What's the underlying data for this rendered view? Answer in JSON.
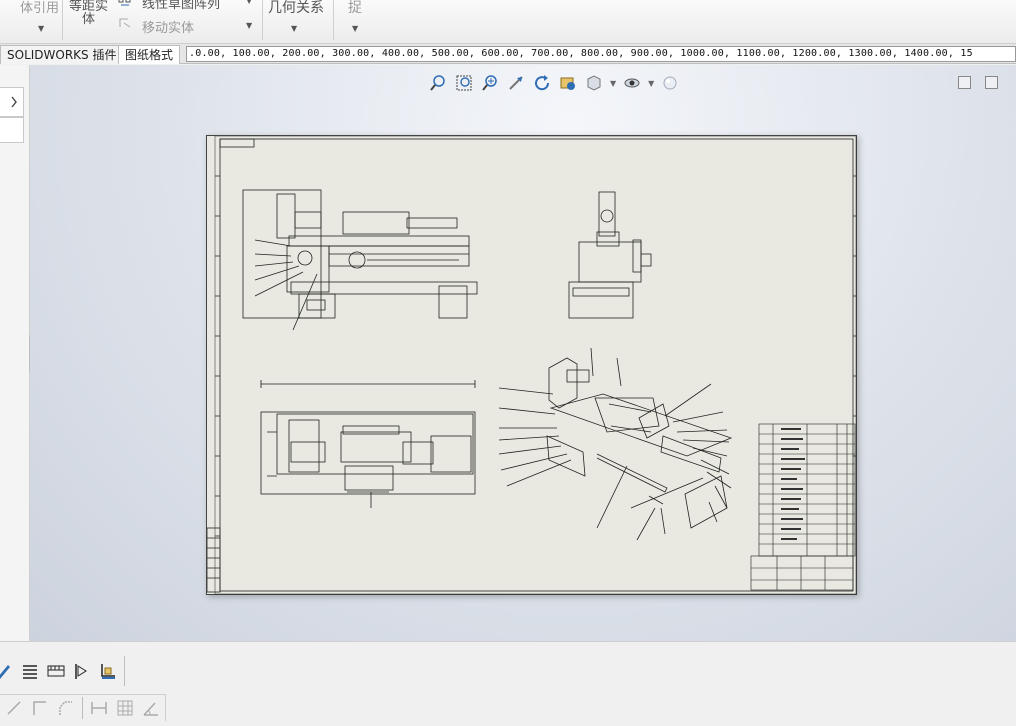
{
  "ribbon": {
    "body_ref": "体引用",
    "equal_body_1": "等距实",
    "equal_body_2": "体",
    "linear_pattern": "线性草图阵列",
    "move_entity": "移动实体",
    "relations": "几何关系",
    "capture": "捉"
  },
  "tabs": {
    "solidworks_addins": "SOLIDWORKS 插件",
    "sheet_format": "图纸格式"
  },
  "ruler": {
    "marks": ".0.00, 100.00, 200.00, 300.00, 400.00, 500.00, 600.00, 700.00, 800.00, 900.00, 1000.00, 1100.00, 1200.00, 1300.00, 1400.00, 15"
  },
  "colors": {
    "sheet": "#e9e9e1",
    "viewport_top": "#f4f6fa",
    "viewport_bottom": "#cdd3de",
    "accent_blue": "#2f6db5"
  },
  "icons": {
    "hud": [
      "zoom-to-fit-icon",
      "zoom-to-area-icon",
      "zoom-in-out-icon",
      "pan-icon",
      "rotate-icon",
      "previous-view-icon",
      "display-style-icon",
      "hide-show-icon",
      "appearance-icon"
    ],
    "bottom_row1": [
      "pencil-icon",
      "lines-icon",
      "hatch-icon",
      "flag-icon",
      "datum-icon"
    ],
    "bottom_row2": [
      "slash-icon",
      "corner-icon",
      "chamfer-icon",
      "dimension-icon",
      "grid-icon",
      "angle-icon"
    ]
  }
}
